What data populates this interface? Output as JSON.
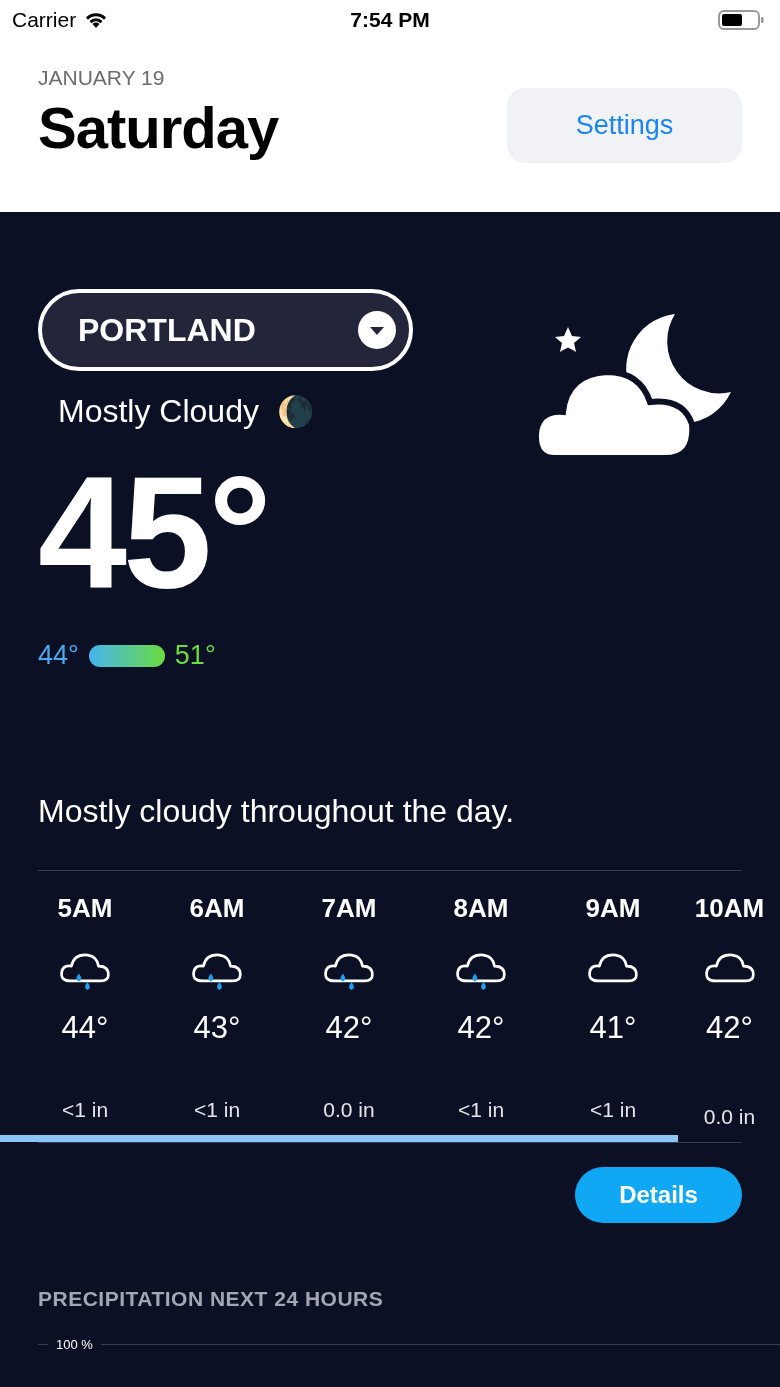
{
  "status_bar": {
    "carrier": "Carrier",
    "time": "7:54 PM"
  },
  "header": {
    "date": "JANUARY 19",
    "day": "Saturday",
    "settings_button": "Settings"
  },
  "location": {
    "name": "PORTLAND"
  },
  "conditions": {
    "summary": "Mostly Cloudy",
    "emoji": "🌘",
    "temperature": "45°",
    "low": "44°",
    "high": "51°",
    "description": "Mostly cloudy throughout the day."
  },
  "hourly": [
    {
      "time": "5AM",
      "kind": "rain",
      "temp": "44°",
      "precip": "<1 in"
    },
    {
      "time": "6AM",
      "kind": "rain",
      "temp": "43°",
      "precip": "<1 in"
    },
    {
      "time": "7AM",
      "kind": "rain",
      "temp": "42°",
      "precip": "0.0 in"
    },
    {
      "time": "8AM",
      "kind": "rain",
      "temp": "42°",
      "precip": "<1 in"
    },
    {
      "time": "9AM",
      "kind": "cloud",
      "temp": "41°",
      "precip": "<1 in"
    },
    {
      "time": "10AM",
      "kind": "cloud",
      "temp": "42°",
      "precip": "0.0 in"
    }
  ],
  "details_button": "Details",
  "precipitation": {
    "title": "PRECIPITATION NEXT 24 HOURS",
    "axis_label": "100 %"
  }
}
